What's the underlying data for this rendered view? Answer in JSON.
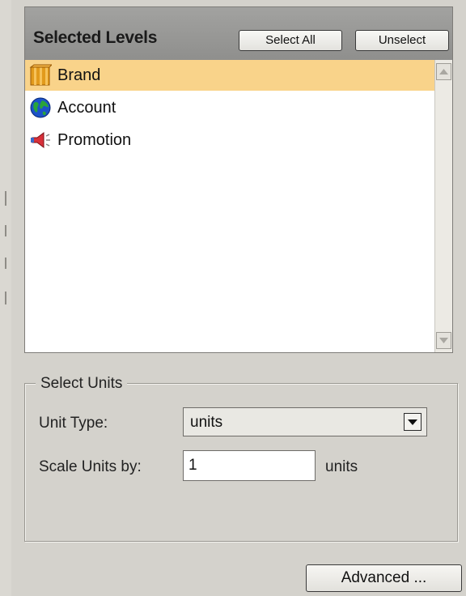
{
  "levels_panel": {
    "title": "Selected Levels",
    "select_all_label": "Select All",
    "unselect_label": "Unselect",
    "items": [
      {
        "label": "Brand",
        "icon": "brand-box-icon",
        "selected": true
      },
      {
        "label": "Account",
        "icon": "globe-icon",
        "selected": false
      },
      {
        "label": "Promotion",
        "icon": "megaphone-icon",
        "selected": false
      }
    ]
  },
  "units_group": {
    "legend": "Select Units",
    "unit_type_label": "Unit Type:",
    "unit_type_value": "units",
    "scale_label": "Scale Units by:",
    "scale_value": "1",
    "scale_suffix": "units"
  },
  "footer": {
    "advanced_label": "Advanced ..."
  },
  "colors": {
    "selected_row": "#f9d38a",
    "header_bg": "#9a9a98",
    "panel_bg": "#d4d2cc"
  }
}
